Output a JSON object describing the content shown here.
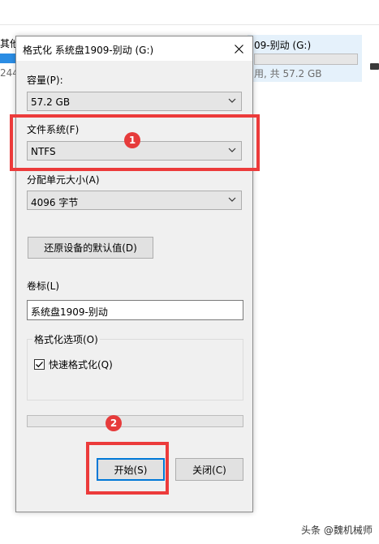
{
  "background": {
    "left_label": "其他",
    "left_sub": "244",
    "drive_name": "系统盘1909-别动 (G:)",
    "drive_tile_name_visible": "09-别动 (G:)",
    "drive_sub": "用, 共 57.2 GB",
    "drive_used_fraction": 0.0
  },
  "dialog": {
    "title": "格式化 系统盘1909-别动 (G:)",
    "capacity_label": "容量(P):",
    "capacity_value": "57.2 GB",
    "filesystem_label": "文件系统(F)",
    "filesystem_value": "NTFS",
    "allocation_label": "分配单元大小(A)",
    "allocation_value": "4096 字节",
    "restore_defaults_label": "还原设备的默认值(D)",
    "volume_label_label": "卷标(L)",
    "volume_label_value": "系统盘1909-别动",
    "format_options_label": "格式化选项(O)",
    "quick_format_label": "快速格式化(Q)",
    "quick_format_checked": true,
    "progress_fraction": 0.0,
    "start_label": "开始(S)",
    "close_label": "关闭(C)"
  },
  "annotations": {
    "marker_1": "1",
    "marker_2": "2",
    "highlight_color": "#ec3b3b"
  },
  "watermark": "头条 @魏机械师",
  "icons": [
    "close-icon",
    "chevron-down-icon",
    "checkmark-icon",
    "drive-icon"
  ],
  "colors": {
    "accent": "#0078d7",
    "dialog_bg": "#f0f0f0",
    "highlight": "#ec3b3b"
  }
}
